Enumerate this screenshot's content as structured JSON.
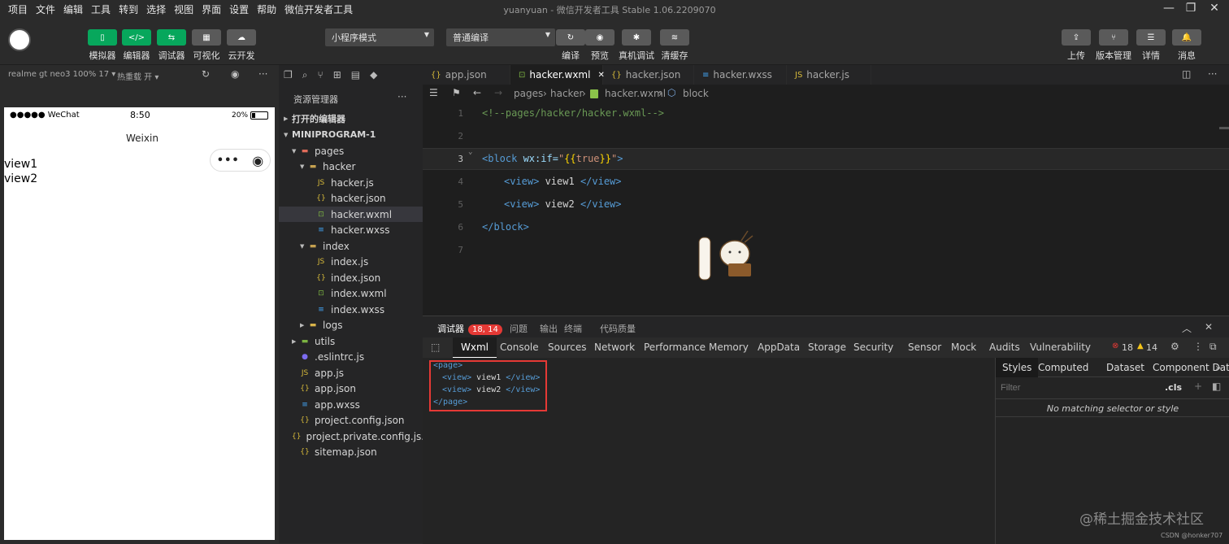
{
  "menu": [
    "项目",
    "文件",
    "编辑",
    "工具",
    "转到",
    "选择",
    "视图",
    "界面",
    "设置",
    "帮助",
    "微信开发者工具"
  ],
  "window_title": "yuanyuan - 微信开发者工具 Stable 1.06.2209070",
  "toolbar": {
    "left_buttons": [
      {
        "label": "模拟器",
        "icon": "phone-icon"
      },
      {
        "label": "编辑器",
        "icon": "code-icon"
      },
      {
        "label": "调试器",
        "icon": "debug-icon"
      },
      {
        "label": "可视化",
        "icon": "layout-icon"
      },
      {
        "label": "云开发",
        "icon": "cloud-icon"
      }
    ],
    "mode_select": "小程序模式",
    "compile_select": "普通编译",
    "middle_buttons": [
      {
        "label": "编译",
        "icon": "refresh-icon"
      },
      {
        "label": "预览",
        "icon": "eye-icon"
      },
      {
        "label": "真机调试",
        "icon": "bug-icon"
      },
      {
        "label": "清缓存",
        "icon": "layers-icon"
      }
    ],
    "right_buttons": [
      {
        "label": "上传",
        "icon": "upload-icon"
      },
      {
        "label": "版本管理",
        "icon": "branch-icon"
      },
      {
        "label": "详情",
        "icon": "menu-icon"
      },
      {
        "label": "消息",
        "icon": "bell-icon"
      }
    ]
  },
  "simulator": {
    "device": "realme gt neo3 100% 17 ▾",
    "hot_reload": "热重载 开 ▾",
    "status_carrier": "●●●●● WeChat",
    "status_time": "8:50",
    "status_battery": "20%",
    "nav_title": "Weixin",
    "views": [
      "view1",
      "view2"
    ]
  },
  "explorer": {
    "title": "资源管理器",
    "open_editors": "打开的编辑器",
    "project": "MINIPROGRAM-1",
    "tree": [
      {
        "label": "pages",
        "type": "folder-red",
        "depth": 1,
        "arrow": "▼"
      },
      {
        "label": "hacker",
        "type": "folder",
        "depth": 2,
        "arrow": "▼"
      },
      {
        "label": "hacker.js",
        "type": "js",
        "depth": 3
      },
      {
        "label": "hacker.json",
        "type": "json",
        "depth": 3
      },
      {
        "label": "hacker.wxml",
        "type": "wxml",
        "depth": 3,
        "selected": true
      },
      {
        "label": "hacker.wxss",
        "type": "wxss",
        "depth": 3
      },
      {
        "label": "index",
        "type": "folder",
        "depth": 2,
        "arrow": "▼"
      },
      {
        "label": "index.js",
        "type": "js",
        "depth": 3
      },
      {
        "label": "index.json",
        "type": "json",
        "depth": 3
      },
      {
        "label": "index.wxml",
        "type": "wxml",
        "depth": 3
      },
      {
        "label": "index.wxss",
        "type": "wxss",
        "depth": 3
      },
      {
        "label": "logs",
        "type": "folder-yellow",
        "depth": 2,
        "arrow": "▶"
      },
      {
        "label": "utils",
        "type": "folder-green",
        "depth": 1,
        "arrow": "▶"
      },
      {
        "label": ".eslintrc.js",
        "type": "eslint",
        "depth": 1
      },
      {
        "label": "app.js",
        "type": "js",
        "depth": 1
      },
      {
        "label": "app.json",
        "type": "json",
        "depth": 1
      },
      {
        "label": "app.wxss",
        "type": "wxss",
        "depth": 1
      },
      {
        "label": "project.config.json",
        "type": "json",
        "depth": 1
      },
      {
        "label": "project.private.config.js...",
        "type": "json",
        "depth": 1
      },
      {
        "label": "sitemap.json",
        "type": "json",
        "depth": 1
      }
    ]
  },
  "editor": {
    "tabs": [
      {
        "label": "app.json",
        "type": "json"
      },
      {
        "label": "hacker.wxml",
        "type": "wxml",
        "active": true
      },
      {
        "label": "hacker.json",
        "type": "json"
      },
      {
        "label": "hacker.wxss",
        "type": "wxss"
      },
      {
        "label": "hacker.js",
        "type": "js"
      }
    ],
    "breadcrumb": [
      "pages",
      "hacker",
      "hacker.wxml",
      "block"
    ],
    "line_numbers": [
      "1",
      "2",
      "3",
      "4",
      "5",
      "6",
      "7"
    ],
    "code": {
      "l1": "<!--pages/hacker/hacker.wxml-->",
      "l3_tag_open": "<block ",
      "l3_attr": "wx:if=",
      "l3_q1": "\"",
      "l3_brace_open": "{{",
      "l3_val": "true",
      "l3_brace_close": "}}",
      "l3_q2": "\"",
      "l3_gt": ">",
      "l4_open": "<view>",
      "l4_text": " view1 ",
      "l4_close": "</view>",
      "l5_open": "<view>",
      "l5_text": " view2 ",
      "l5_close": "</view>",
      "l6": "</block>"
    }
  },
  "debugger": {
    "tabs": [
      {
        "label": "调试器",
        "badge": "18, 14",
        "active": true
      },
      {
        "label": "问题"
      },
      {
        "label": "输出"
      },
      {
        "label": "终端"
      },
      {
        "label": "代码质量"
      }
    ],
    "devtools_tabs": [
      "Wxml",
      "Console",
      "Sources",
      "Network",
      "Performance",
      "Memory",
      "AppData",
      "Storage",
      "Security",
      "Sensor",
      "Mock",
      "Audits",
      "Vulnerability"
    ],
    "errors": "18",
    "warnings": "14",
    "wxml_tree": {
      "page_open": "<page>",
      "v1_open": "<view>",
      "v1_text": " view1 ",
      "v1_close": "</view>",
      "v2_open": "<view>",
      "v2_text": " view2 ",
      "v2_close": "</view>",
      "page_close": "</page>"
    },
    "styles_tabs": [
      "Styles",
      "Computed",
      "Dataset",
      "Component Data"
    ],
    "filter_placeholder": "Filter",
    "cls": ".cls",
    "no_match": "No matching selector or style"
  },
  "watermark": "@稀土掘金技术社区",
  "watermark2": "CSDN @honker707",
  "colors": {
    "accent_green": "#07a75c",
    "badge_red": "#e53935"
  }
}
